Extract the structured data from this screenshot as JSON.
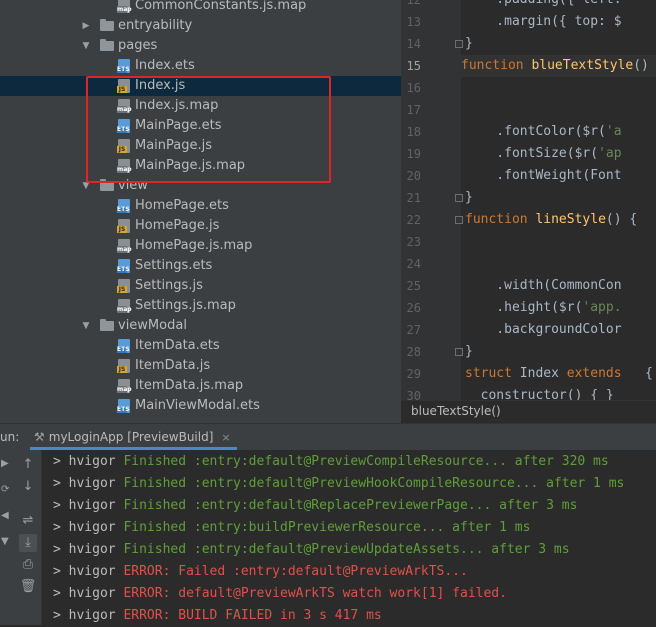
{
  "project_tree": {
    "items": [
      {
        "label": "CommonConstants.js.map",
        "kind": "map",
        "indent": 3,
        "chevron": "",
        "selected": false
      },
      {
        "label": "entryability",
        "kind": "folder",
        "indent": 2,
        "chevron": "collapsed",
        "selected": false
      },
      {
        "label": "pages",
        "kind": "folder",
        "indent": 2,
        "chevron": "expanded",
        "selected": false
      },
      {
        "label": "Index.ets",
        "kind": "ets",
        "indent": 3,
        "chevron": "",
        "selected": false
      },
      {
        "label": "Index.js",
        "kind": "js",
        "indent": 3,
        "chevron": "",
        "selected": true
      },
      {
        "label": "Index.js.map",
        "kind": "map",
        "indent": 3,
        "chevron": "",
        "selected": false
      },
      {
        "label": "MainPage.ets",
        "kind": "ets",
        "indent": 3,
        "chevron": "",
        "selected": false
      },
      {
        "label": "MainPage.js",
        "kind": "js",
        "indent": 3,
        "chevron": "",
        "selected": false
      },
      {
        "label": "MainPage.js.map",
        "kind": "map",
        "indent": 3,
        "chevron": "",
        "selected": false
      },
      {
        "label": "view",
        "kind": "folder",
        "indent": 2,
        "chevron": "expanded",
        "selected": false
      },
      {
        "label": "HomePage.ets",
        "kind": "ets",
        "indent": 3,
        "chevron": "",
        "selected": false
      },
      {
        "label": "HomePage.js",
        "kind": "js",
        "indent": 3,
        "chevron": "",
        "selected": false
      },
      {
        "label": "HomePage.js.map",
        "kind": "map",
        "indent": 3,
        "chevron": "",
        "selected": false
      },
      {
        "label": "Settings.ets",
        "kind": "ets",
        "indent": 3,
        "chevron": "",
        "selected": false
      },
      {
        "label": "Settings.js",
        "kind": "js",
        "indent": 3,
        "chevron": "",
        "selected": false
      },
      {
        "label": "Settings.js.map",
        "kind": "map",
        "indent": 3,
        "chevron": "",
        "selected": false
      },
      {
        "label": "viewModal",
        "kind": "folder",
        "indent": 2,
        "chevron": "expanded",
        "selected": false
      },
      {
        "label": "ItemData.ets",
        "kind": "ets",
        "indent": 3,
        "chevron": "",
        "selected": false
      },
      {
        "label": "ItemData.js",
        "kind": "js",
        "indent": 3,
        "chevron": "",
        "selected": false
      },
      {
        "label": "ItemData.js.map",
        "kind": "map",
        "indent": 3,
        "chevron": "",
        "selected": false
      },
      {
        "label": "MainViewModal.ets",
        "kind": "ets",
        "indent": 3,
        "chevron": "",
        "selected": false
      }
    ],
    "file_tags": {
      "ets": "ETS",
      "js": "JS",
      "map": "map"
    },
    "highlight_color": "#e0252a"
  },
  "editor": {
    "lines": [
      {
        "num": "12",
        "text": "    .padding({ left:",
        "fold": false
      },
      {
        "num": "13",
        "text": "    .margin({ top: $",
        "fold": false
      },
      {
        "num": "14",
        "text": "}",
        "fold": true
      },
      {
        "num": "15",
        "text": "function blueTextStyle()",
        "fold": false,
        "current": true
      },
      {
        "num": "16",
        "text": "",
        "fold": false
      },
      {
        "num": "17",
        "text": "",
        "fold": false
      },
      {
        "num": "18",
        "text": "    .fontColor($r('a",
        "fold": false
      },
      {
        "num": "19",
        "text": "    .fontSize($r('ap",
        "fold": false
      },
      {
        "num": "20",
        "text": "    .fontWeight(Font",
        "fold": false
      },
      {
        "num": "21",
        "text": "}",
        "fold": true
      },
      {
        "num": "22",
        "text": "function lineStyle() {",
        "fold": true
      },
      {
        "num": "23",
        "text": "",
        "fold": false
      },
      {
        "num": "24",
        "text": "",
        "fold": false
      },
      {
        "num": "25",
        "text": "    .width(CommonCon",
        "fold": false
      },
      {
        "num": "26",
        "text": "    .height($r('app.",
        "fold": false
      },
      {
        "num": "27",
        "text": "    .backgroundColor",
        "fold": false
      },
      {
        "num": "28",
        "text": "}",
        "fold": true
      },
      {
        "num": "29",
        "text": "struct Index extends   {",
        "fold": false
      },
      {
        "num": "30",
        "text": "  constructor() { }",
        "fold": false
      }
    ],
    "breadcrumb": "blueTextStyle()"
  },
  "run_panel": {
    "label": "un:",
    "tab_title": "myLoginApp [PreviewBuild]",
    "close_glyph": "×",
    "toolbar": [
      {
        "name": "rerun-icon",
        "glyph": "↑"
      },
      {
        "name": "scroll-down-icon",
        "glyph": "↓"
      },
      {
        "name": "soft-wrap-icon",
        "glyph": "⇌"
      },
      {
        "name": "scroll-to-end-icon",
        "glyph": "⤓"
      },
      {
        "name": "print-icon",
        "glyph": "⎙"
      },
      {
        "name": "trash-icon",
        "glyph": "🗑"
      }
    ],
    "side_glyphs": [
      "▶",
      "⟳",
      "◀",
      "▼"
    ],
    "console": [
      {
        "prefix": "> hvigor ",
        "msg": "Finished :entry:default@PreviewCompileResource... after 320 ms",
        "level": "ok"
      },
      {
        "prefix": "> hvigor ",
        "msg": "Finished :entry:default@PreviewHookCompileResource... after 1 ms",
        "level": "ok"
      },
      {
        "prefix": "> hvigor ",
        "msg": "Finished :entry:default@ReplacePreviewerPage... after 3 ms",
        "level": "ok"
      },
      {
        "prefix": "> hvigor ",
        "msg": "Finished :entry:buildPreviewerResource... after 1 ms",
        "level": "ok"
      },
      {
        "prefix": "> hvigor ",
        "msg": "Finished :entry:default@PreviewUpdateAssets... after 3 ms",
        "level": "ok"
      },
      {
        "prefix": "> hvigor ",
        "msg": "ERROR: Failed :entry:default@PreviewArkTS...",
        "level": "bad"
      },
      {
        "prefix": "> hvigor ",
        "msg": "ERROR: default@PreviewArkTS watch work[1] failed.",
        "level": "bad"
      },
      {
        "prefix": "> hvigor ",
        "msg": "ERROR: BUILD FAILED in 3 s 417 ms",
        "level": "bad"
      }
    ]
  }
}
